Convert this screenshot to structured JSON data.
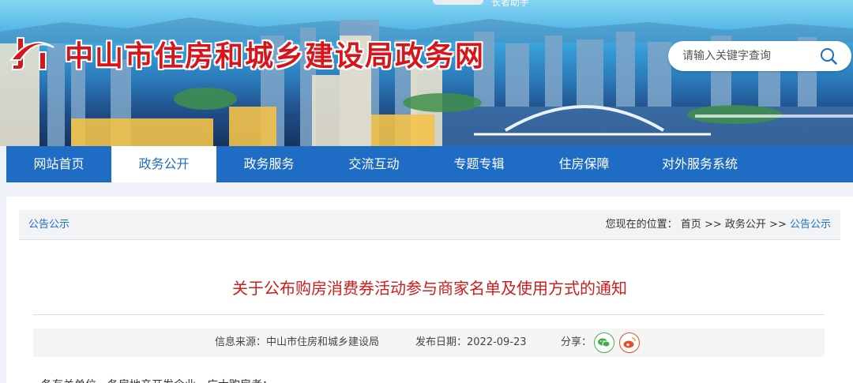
{
  "header": {
    "site_title": "中山市住房和城乡建设局政务网",
    "top_link": "长者助手",
    "search": {
      "placeholder": "请输入关键字查询"
    }
  },
  "nav": {
    "items": [
      {
        "label": "网站首页",
        "active": false
      },
      {
        "label": "政务公开",
        "active": true
      },
      {
        "label": "政务服务",
        "active": false
      },
      {
        "label": "交流互动",
        "active": false
      },
      {
        "label": "专题专辑",
        "active": false
      },
      {
        "label": "住房保障",
        "active": false
      },
      {
        "label": "对外服务系统",
        "active": false
      }
    ]
  },
  "breadcrumb": {
    "section": "公告公示",
    "prefix": "您现在的位置：",
    "home": "首页",
    "sep": ">>",
    "level2": "政务公开",
    "current": "公告公示"
  },
  "article": {
    "title": "关于公布购房消费券活动参与商家名单及使用方式的通知",
    "source_label": "信息来源：",
    "source": "中山市住房和城乡建设局",
    "date_label": "发布日期：",
    "date": "2022-09-23",
    "share_label": "分享：",
    "body_first_line": "各有关单位、各房地产开发企业、广大购房者："
  },
  "colors": {
    "brand_red": "#d7161b",
    "nav_blue": "#1f6cc4",
    "title_red": "#d01c1c",
    "wechat_green": "#3fae49",
    "weibo_orange": "#e2502b"
  }
}
